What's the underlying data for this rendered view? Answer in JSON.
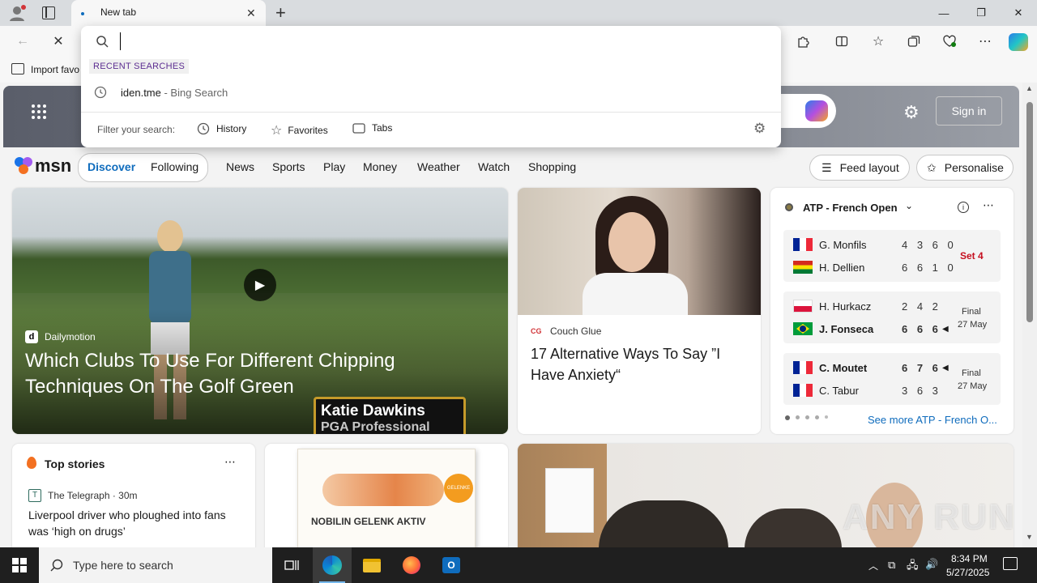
{
  "browser": {
    "tab_title": "New tab",
    "new_tab_symbol": "+",
    "minimize": "—",
    "maximize": "❐",
    "close": "✕"
  },
  "favorites_bar": {
    "import_label": "Import favo"
  },
  "address_dropdown": {
    "input_value": "",
    "recent_header": "RECENT SEARCHES",
    "recent_items": [
      {
        "query": "iden.tme",
        "suffix": " - Bing Search"
      }
    ],
    "filter_label": "Filter your search:",
    "filters": [
      "History",
      "Favorites",
      "Tabs"
    ]
  },
  "msn_header": {
    "sign_in": "Sign in"
  },
  "msn_nav": {
    "logo": "msn",
    "toggle": [
      "Discover",
      "Following"
    ],
    "items": [
      "News",
      "Sports",
      "Play",
      "Money",
      "Weather",
      "Watch",
      "Shopping"
    ],
    "feed_layout": "Feed layout",
    "personalise": "Personalise"
  },
  "hero": {
    "source": "Dailymotion",
    "title": "Which Clubs To Use For Different Chipping Techniques On The Golf Green",
    "overlay_name": "Katie Dawkins",
    "overlay_role": "PGA Professional"
  },
  "article2": {
    "source": "Couch Glue",
    "title": "17 Alternative Ways To Say ”I Have Anxiety“"
  },
  "sports": {
    "title": "ATP - French Open",
    "see_more": "See more ATP - French O...",
    "matches": [
      {
        "p1": "G. Monfils",
        "s1": "4 3 6 0",
        "p2": "H. Dellien",
        "s2": "6 6 1 0",
        "status": "Set 4",
        "status2": "",
        "live": true,
        "c1": [
          "#002395",
          "#ffffff",
          "#ed2939"
        ],
        "c2": [
          "#d52b1e",
          "#f9e300",
          "#007934"
        ]
      },
      {
        "p1": "H. Hurkacz",
        "s1": "2 4 2",
        "p2": "J. Fonseca",
        "s2": "6 6 6",
        "status": "Final",
        "status2": "27 May",
        "live": false,
        "c1": [
          "#ffffff",
          "#dc143c"
        ],
        "c2": [
          "#009c3b",
          "#ffdf00"
        ]
      },
      {
        "p1": "C. Moutet",
        "s1": "6 7 6",
        "p2": "C. Tabur",
        "s2": "3 6 3",
        "status": "Final",
        "status2": "27 May",
        "live": false,
        "c1": [
          "#002395",
          "#ffffff",
          "#ed2939"
        ],
        "c2": [
          "#002395",
          "#ffffff",
          "#ed2939"
        ]
      }
    ]
  },
  "top_stories": {
    "title": "Top stories",
    "source": "The Telegraph · 30m",
    "headline": "Liverpool driver who ploughed into fans was ‘high on drugs’"
  },
  "ad": {
    "product": "NOBILIN GELENK AKTIV",
    "badge": "GELENKE"
  },
  "watermark": "ANY RUN",
  "taskbar": {
    "search_placeholder": "Type here to search",
    "time": "8:34 PM",
    "date": "5/27/2025"
  }
}
